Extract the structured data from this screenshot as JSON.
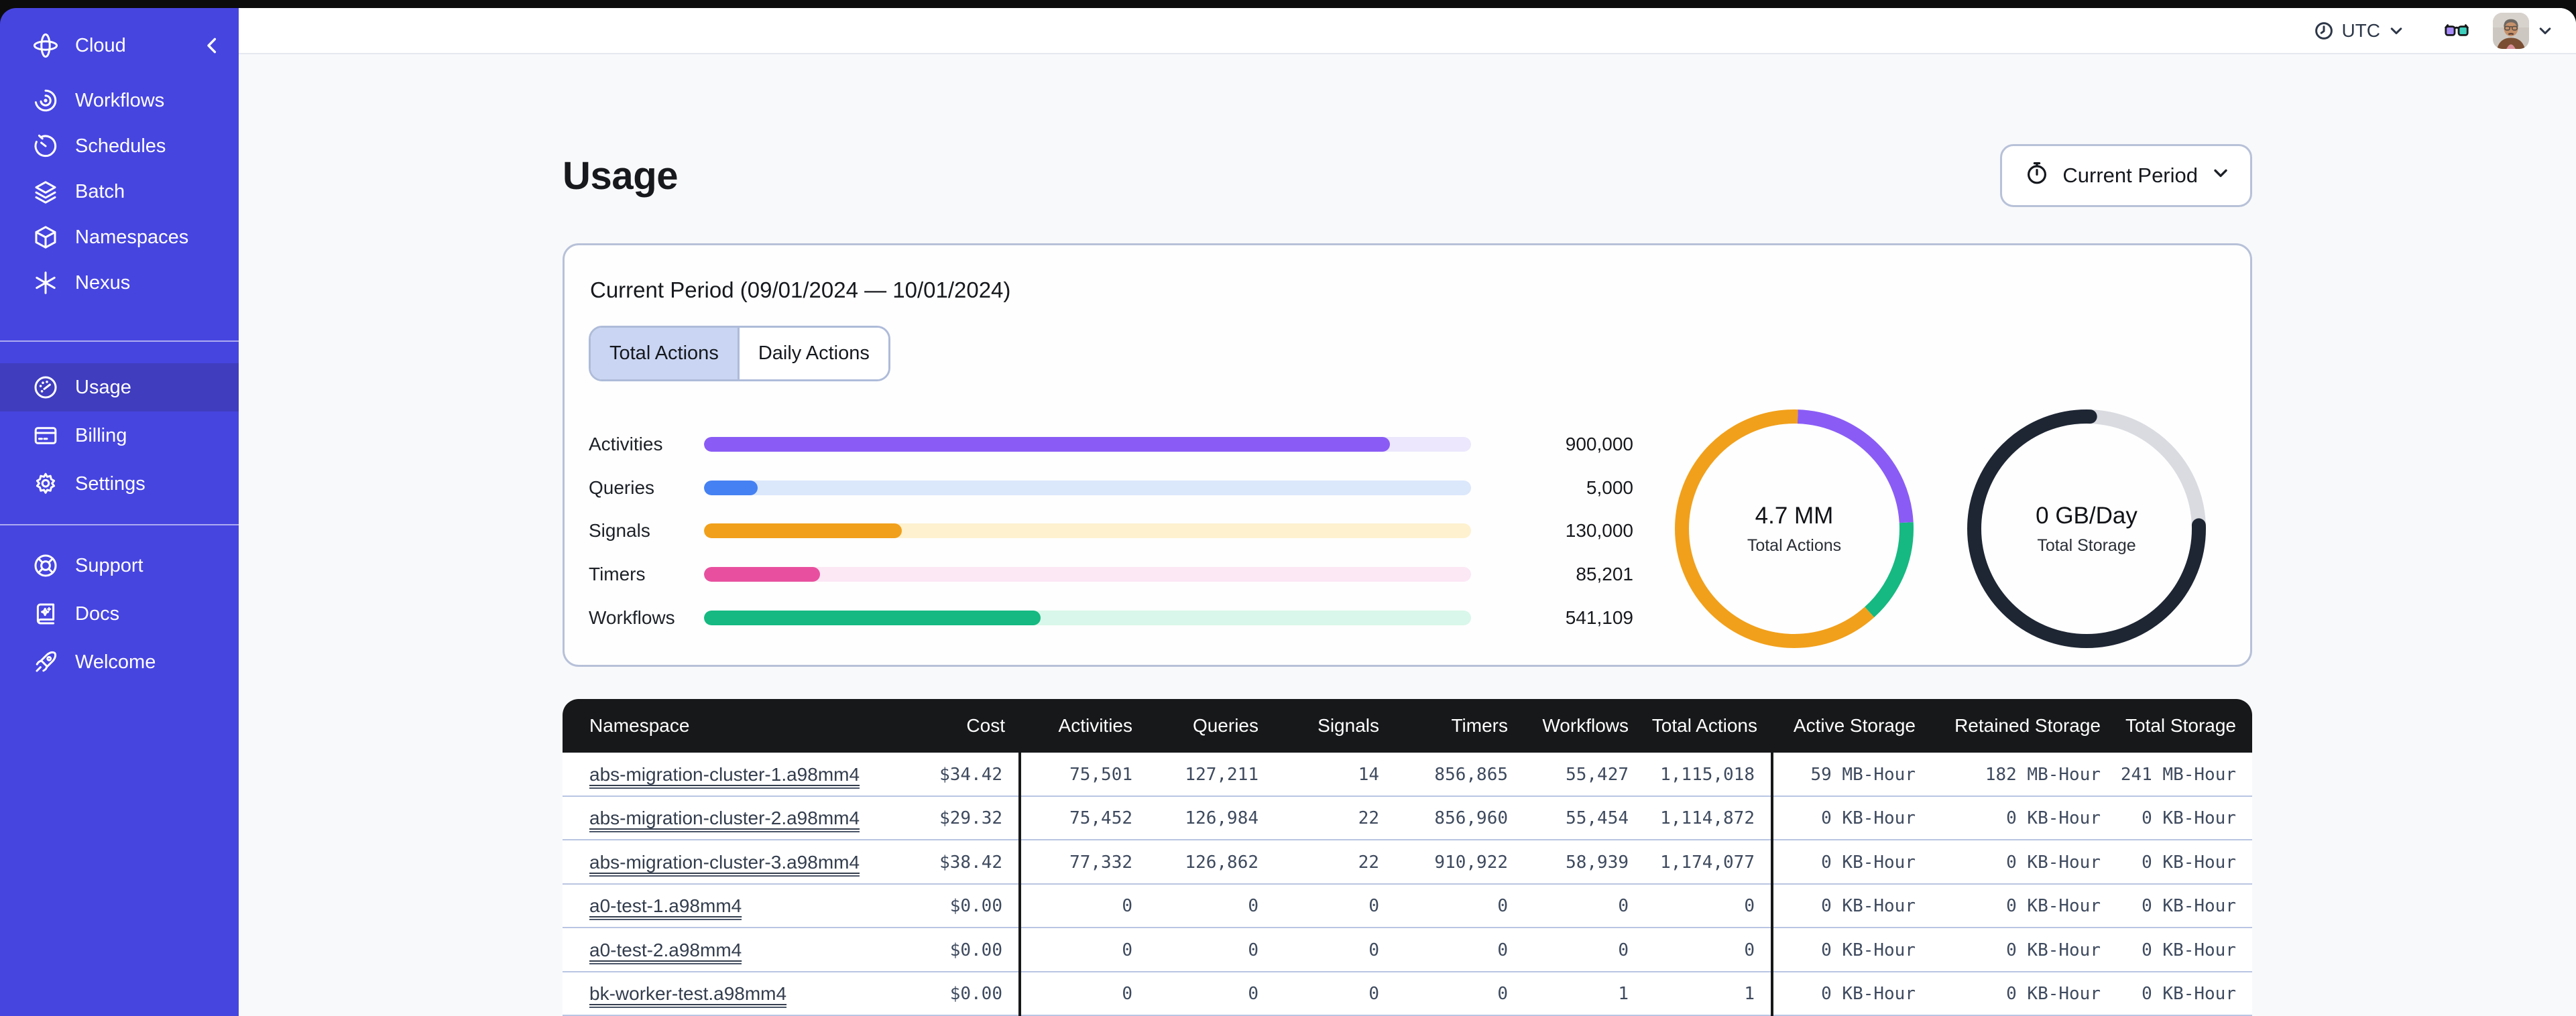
{
  "topbar": {
    "timezone": "UTC"
  },
  "sidebar": {
    "brand": "Cloud",
    "nav": [
      {
        "icon": "workflows-icon",
        "label": "Workflows"
      },
      {
        "icon": "schedules-icon",
        "label": "Schedules"
      },
      {
        "icon": "batch-icon",
        "label": "Batch"
      },
      {
        "icon": "namespaces-icon",
        "label": "Namespaces"
      },
      {
        "icon": "nexus-icon",
        "label": "Nexus"
      }
    ],
    "account": [
      {
        "icon": "usage-icon",
        "label": "Usage",
        "active": true
      },
      {
        "icon": "billing-icon",
        "label": "Billing"
      },
      {
        "icon": "settings-icon",
        "label": "Settings"
      }
    ],
    "help": [
      {
        "icon": "support-icon",
        "label": "Support"
      },
      {
        "icon": "docs-icon",
        "label": "Docs"
      },
      {
        "icon": "welcome-icon",
        "label": "Welcome"
      }
    ]
  },
  "page": {
    "title": "Usage",
    "period_selector": "Current Period"
  },
  "card": {
    "title": "Current Period (09/01/2024 — 10/01/2024)",
    "tabs": [
      {
        "label": "Total Actions",
        "selected": true
      },
      {
        "label": "Daily Actions",
        "selected": false
      }
    ]
  },
  "chart_data": [
    {
      "type": "bar",
      "orientation": "horizontal",
      "categories": [
        "Activities",
        "Queries",
        "Signals",
        "Timers",
        "Workflows"
      ],
      "values": [
        900000,
        5000,
        130000,
        85201,
        541109
      ],
      "value_labels": [
        "900,000",
        "5,000",
        "130,000",
        "85,201",
        "541,109"
      ],
      "colors": [
        "#8a5cf5",
        "#4581f2",
        "#f1a01b",
        "#e8509f",
        "#15b981"
      ],
      "track_colors": [
        "#ece7fc",
        "#dbe7fb",
        "#fdf1cf",
        "#fce7f5",
        "#d9f7ea"
      ],
      "bar_fractions": [
        0.894,
        0.07,
        0.258,
        0.151,
        0.439
      ]
    },
    {
      "type": "donut",
      "center_value": "4.7 MM",
      "center_label": "Total Actions",
      "segments": [
        {
          "name": "activities",
          "color": "#8a5cf5",
          "fraction": 0.236
        },
        {
          "name": "workflows",
          "color": "#15b981",
          "fraction": 0.142
        },
        {
          "name": "signals",
          "color": "#f1a01b",
          "fraction": 0.622
        }
      ]
    },
    {
      "type": "donut",
      "center_value": "0 GB/Day",
      "center_label": "Total Storage",
      "segments": [
        {
          "name": "retained",
          "color": "#d9dbe0",
          "fraction": 0.24
        },
        {
          "name": "active",
          "color": "#1e2634",
          "fraction": 0.76
        }
      ]
    }
  ],
  "table": {
    "columns": [
      "Namespace",
      "Cost",
      "Activities",
      "Queries",
      "Signals",
      "Timers",
      "Workflows",
      "Total Actions",
      "Active Storage",
      "Retained Storage",
      "Total Storage"
    ],
    "rows": [
      [
        "abs-migration-cluster-1.a98mm4",
        "$34.42",
        "75,501",
        "127,211",
        "14",
        "856,865",
        "55,427",
        "1,115,018",
        "59 MB-Hour",
        "182 MB-Hour",
        "241 MB-Hour"
      ],
      [
        "abs-migration-cluster-2.a98mm4",
        "$29.32",
        "75,452",
        "126,984",
        "22",
        "856,960",
        "55,454",
        "1,114,872",
        "0 KB-Hour",
        "0 KB-Hour",
        "0 KB-Hour"
      ],
      [
        "abs-migration-cluster-3.a98mm4",
        "$38.42",
        "77,332",
        "126,862",
        "22",
        "910,922",
        "58,939",
        "1,174,077",
        "0 KB-Hour",
        "0 KB-Hour",
        "0 KB-Hour"
      ],
      [
        "a0-test-1.a98mm4",
        "$0.00",
        "0",
        "0",
        "0",
        "0",
        "0",
        "0",
        "0 KB-Hour",
        "0 KB-Hour",
        "0 KB-Hour"
      ],
      [
        "a0-test-2.a98mm4",
        "$0.00",
        "0",
        "0",
        "0",
        "0",
        "0",
        "0",
        "0 KB-Hour",
        "0 KB-Hour",
        "0 KB-Hour"
      ],
      [
        "bk-worker-test.a98mm4",
        "$0.00",
        "0",
        "0",
        "0",
        "0",
        "1",
        "1",
        "0 KB-Hour",
        "0 KB-Hour",
        "0 KB-Hour"
      ]
    ]
  }
}
